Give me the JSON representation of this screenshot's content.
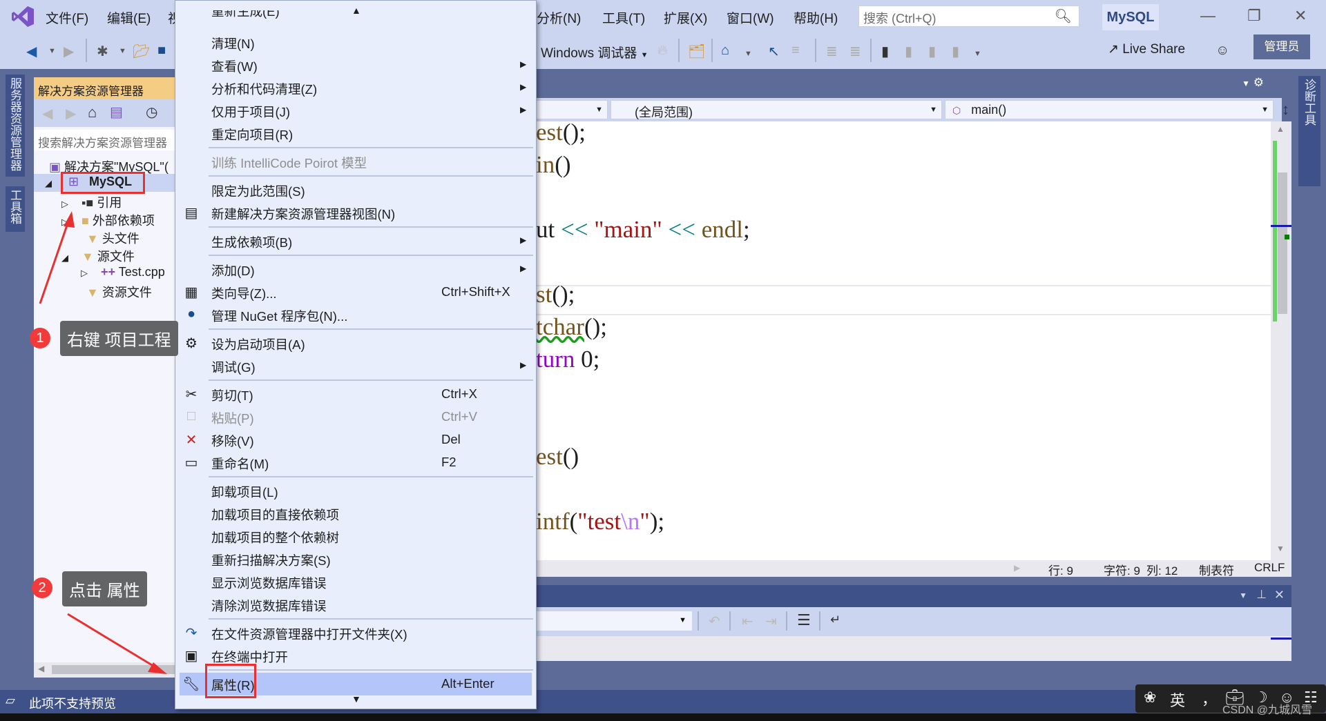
{
  "menubar": {
    "items": [
      "文件(F)",
      "编辑(E)",
      "视",
      "分析(N)",
      "工具(T)",
      "扩展(X)",
      "窗口(W)",
      "帮助(H)"
    ],
    "search_placeholder": "搜索 (Ctrl+Q)",
    "solution_name": "MySQL"
  },
  "toolbar": {
    "debugger_label": "Windows 调试器",
    "live_share": "Live Share",
    "admin_badge": "管理员"
  },
  "side_tabs": {
    "server_explorer": "服务器资源管理器",
    "toolbox": "工具箱",
    "diagnostic_tools": "诊断工具"
  },
  "solution_explorer": {
    "title": "解决方案资源管理器",
    "search_placeholder": "搜索解决方案资源管理器",
    "tree": [
      {
        "label": "解决方案\"MySQL\"(",
        "icon": "solution-icon",
        "expanded": null
      },
      {
        "label": "MySQL",
        "icon": "project-cpp-icon",
        "expanded": true,
        "selected": true
      },
      {
        "label": "引用",
        "icon": "references-icon",
        "expanded": false
      },
      {
        "label": "外部依赖项",
        "icon": "external-deps-folder-icon",
        "expanded": false
      },
      {
        "label": "头文件",
        "icon": "filter-folder-icon",
        "expanded": null
      },
      {
        "label": "源文件",
        "icon": "filter-folder-icon",
        "expanded": true
      },
      {
        "label": "Test.cpp",
        "icon": "cpp-file-icon",
        "expanded": false
      },
      {
        "label": "资源文件",
        "icon": "filter-folder-icon",
        "expanded": null
      }
    ]
  },
  "editor": {
    "scope_dropdown": "(全局范围)",
    "member_dropdown": "main()",
    "code_lines": [
      [
        {
          "t": "est",
          "c": "fn"
        },
        {
          "t": "();",
          "c": "pl"
        }
      ],
      [
        {
          "t": "in",
          "c": "fn"
        },
        {
          "t": "()",
          "c": "pl"
        }
      ],
      [],
      [
        {
          "t": "ut ",
          "c": "pl"
        },
        {
          "t": "<<",
          "c": "op"
        },
        {
          "t": " ",
          "c": "pl"
        },
        {
          "t": "\"main\"",
          "c": "str"
        },
        {
          "t": " ",
          "c": "pl"
        },
        {
          "t": "<<",
          "c": "op"
        },
        {
          "t": " endl",
          "c": "fn"
        },
        {
          "t": ";",
          "c": "pl"
        }
      ],
      [],
      [
        {
          "t": "st",
          "c": "fn"
        },
        {
          "t": "();",
          "c": "pl"
        }
      ],
      [
        {
          "t": "tchar",
          "c": "fn"
        },
        {
          "t": "();",
          "c": "pl"
        }
      ],
      [
        {
          "t": "turn",
          "c": "kw"
        },
        {
          "t": " 0;",
          "c": "pl"
        }
      ],
      [],
      [],
      [
        {
          "t": "est",
          "c": "fn"
        },
        {
          "t": "()",
          "c": "pl"
        }
      ],
      [],
      [
        {
          "t": "intf",
          "c": "fn"
        },
        {
          "t": "(",
          "c": "pl"
        },
        {
          "t": "\"test",
          "c": "str"
        },
        {
          "t": "\\n",
          "c": "esc"
        },
        {
          "t": "\"",
          "c": "str"
        },
        {
          "t": ");",
          "c": "pl"
        }
      ]
    ],
    "status": {
      "line": "行: 9",
      "char": "字符: 9",
      "col": "列: 12",
      "tabs": "制表符",
      "eol": "CRLF"
    }
  },
  "context_menu": {
    "items": [
      {
        "label": "重新生成(E)",
        "clipped": true
      },
      {
        "label": "清理(N)"
      },
      {
        "label": "查看(W)",
        "submenu": true
      },
      {
        "label": "分析和代码清理(Z)",
        "submenu": true
      },
      {
        "label": "仅用于项目(J)",
        "submenu": true
      },
      {
        "label": "重定向项目(R)"
      },
      {
        "sep": true
      },
      {
        "label": "训练 IntelliCode Poirot 模型",
        "disabled": true
      },
      {
        "sep": true
      },
      {
        "label": "限定为此范围(S)"
      },
      {
        "label": "新建解决方案资源管理器视图(N)",
        "icon": "new-view-icon"
      },
      {
        "sep": true
      },
      {
        "label": "生成依赖项(B)",
        "submenu": true
      },
      {
        "sep": true
      },
      {
        "label": "添加(D)",
        "submenu": true
      },
      {
        "label": "类向导(Z)...",
        "shortcut": "Ctrl+Shift+X",
        "icon": "class-wizard-icon"
      },
      {
        "label": "管理 NuGet 程序包(N)...",
        "icon": "nuget-icon"
      },
      {
        "sep": true
      },
      {
        "label": "设为启动项目(A)",
        "icon": "gear-icon"
      },
      {
        "label": "调试(G)",
        "submenu": true
      },
      {
        "sep": true
      },
      {
        "label": "剪切(T)",
        "shortcut": "Ctrl+X",
        "icon": "scissors-icon"
      },
      {
        "label": "粘贴(P)",
        "shortcut": "Ctrl+V",
        "icon": "paste-icon",
        "disabled": true
      },
      {
        "label": "移除(V)",
        "shortcut": "Del",
        "icon": "remove-x-icon"
      },
      {
        "label": "重命名(M)",
        "shortcut": "F2",
        "icon": "rename-icon"
      },
      {
        "sep": true
      },
      {
        "label": "卸载项目(L)"
      },
      {
        "label": "加载项目的直接依赖项"
      },
      {
        "label": "加载项目的整个依赖树"
      },
      {
        "label": "重新扫描解决方案(S)"
      },
      {
        "label": "显示浏览数据库错误"
      },
      {
        "label": "清除浏览数据库错误"
      },
      {
        "sep": true
      },
      {
        "label": "在文件资源管理器中打开文件夹(X)",
        "icon": "open-folder-arrow-icon"
      },
      {
        "label": "在终端中打开",
        "icon": "terminal-icon"
      },
      {
        "sep": true
      },
      {
        "label": "属性(R)",
        "shortcut": "Alt+Enter",
        "icon": "wrench-icon",
        "highlighted": true
      }
    ]
  },
  "annotations": {
    "step1": {
      "badge": "1",
      "text": "右键 项目工程"
    },
    "step2": {
      "badge": "2",
      "text": "点击 属性"
    }
  },
  "statusbar": {
    "message": "此项不支持预览"
  },
  "ime": {
    "lang": "英",
    "punct": "，"
  },
  "watermark": "CSDN @九城风雪"
}
